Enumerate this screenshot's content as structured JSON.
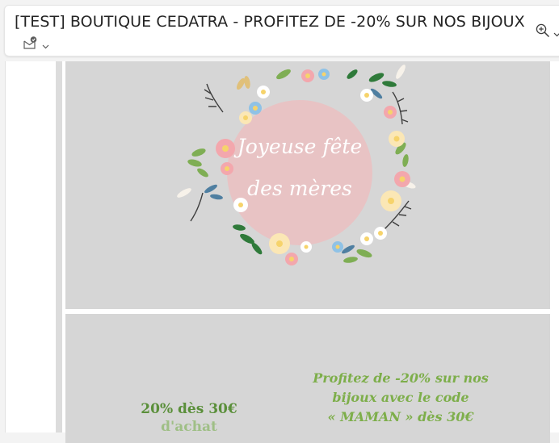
{
  "email": {
    "subject": "[TEST] BOUTIQUE CEDATRA - PROFITEZ DE -20% SUR NOS BIJOUX"
  },
  "banner": {
    "line1": "Joyeuse fête",
    "line2": "des mères"
  },
  "promo": {
    "left_line1": "20% dès 30€",
    "left_line2": "d'achat",
    "right_line1": "Profitez de -20% sur nos",
    "right_line2": "bijoux avec le code",
    "right_line3": "« MAMAN » dès 30€"
  },
  "icons": {
    "mail": "mail-envelope-check-icon",
    "zoom": "zoom-in-icon",
    "chevron": "chevron-down-icon"
  },
  "colors": {
    "green_text": "#5a8f3a",
    "banner_bg": "#d6d6d6",
    "wreath_pink": "#e8c3c4"
  }
}
